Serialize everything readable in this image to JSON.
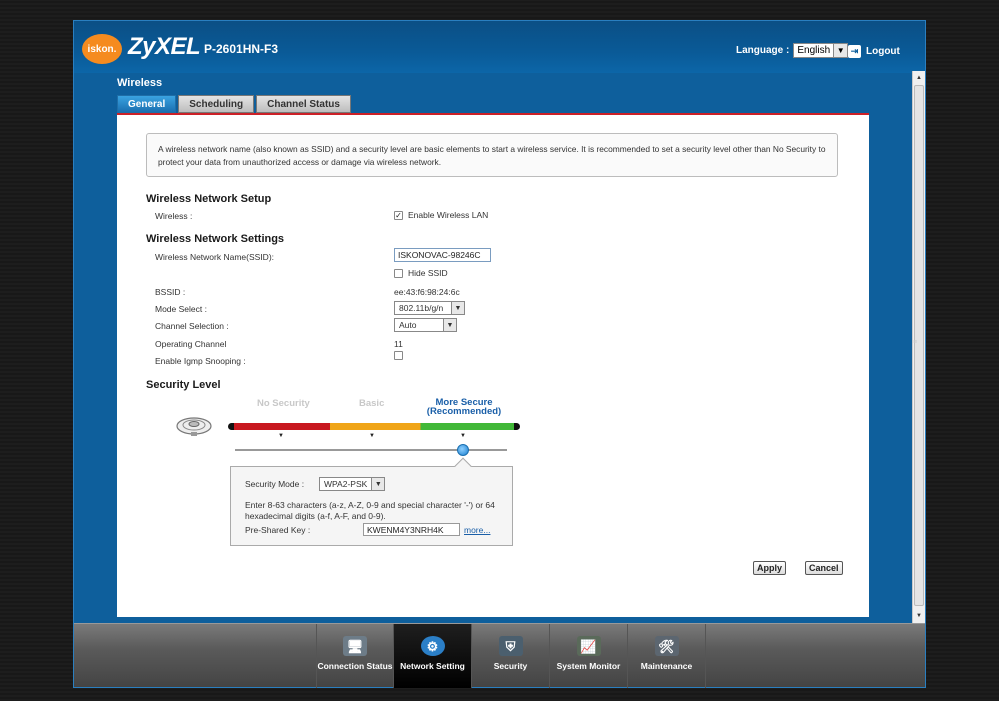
{
  "header": {
    "logo_text": "iskon.",
    "brand": "ZyXEL",
    "model": "P-2601HN-F3",
    "language_label": "Language :",
    "language_value": "English",
    "logout_label": "Logout"
  },
  "page": {
    "title": "Wireless",
    "tabs": [
      {
        "label": "General",
        "active": true
      },
      {
        "label": "Scheduling",
        "active": false
      },
      {
        "label": "Channel Status",
        "active": false
      }
    ]
  },
  "info_text": "A wireless network name (also known as SSID) and a security level are basic elements to start a wireless service. It is recommended to set a security level other than No Security to protect your data from unauthorized access or damage via wireless network.",
  "network_setup": {
    "title": "Wireless Network Setup",
    "wireless_label": "Wireless :",
    "enable_label": "Enable Wireless LAN",
    "enable_checked": true
  },
  "network_settings": {
    "title": "Wireless Network Settings",
    "ssid_label": "Wireless Network Name(SSID):",
    "ssid_value": "ISKONOVAC-98246C",
    "hide_ssid_label": "Hide SSID",
    "hide_ssid_checked": false,
    "bssid_label": "BSSID :",
    "bssid_value": "ee:43:f6:98:24:6c",
    "mode_label": "Mode Select :",
    "mode_value": "802.11b/g/n",
    "channel_label": "Channel Selection :",
    "channel_value": "Auto",
    "operating_label": "Operating Channel",
    "operating_value": "11",
    "igmp_label": "Enable Igmp Snooping :",
    "igmp_checked": false
  },
  "security": {
    "title": "Security Level",
    "levels": [
      "No Security",
      "Basic",
      "More Secure\n(Recommended)"
    ],
    "level_colors": {
      "No Security": "#c8181f",
      "Basic": "#f0a518",
      "More Secure": "#41b838"
    },
    "selected_level": "More Secure (Recommended)",
    "mode_label": "Security Mode :",
    "mode_value": "WPA2-PSK",
    "hint": "Enter 8-63 characters (a-z, A-Z, 0-9 and special character '-') or 64 hexadecimal digits (a-f, A-F, and 0-9).",
    "psk_label": "Pre-Shared Key :",
    "psk_value": "KWENM4Y3NRH4K",
    "more_label": "more..."
  },
  "actions": {
    "apply_label": "Apply",
    "cancel_label": "Cancel"
  },
  "bottom_nav": [
    {
      "label": "Connection Status",
      "icon": "connection-status-icon",
      "active": false
    },
    {
      "label": "Network Setting",
      "icon": "network-setting-icon",
      "active": true
    },
    {
      "label": "Security",
      "icon": "security-shield-icon",
      "active": false
    },
    {
      "label": "System Monitor",
      "icon": "system-monitor-icon",
      "active": false
    },
    {
      "label": "Maintenance",
      "icon": "maintenance-icon",
      "active": false
    }
  ],
  "colors": {
    "accent_blue": "#0e5f9c",
    "logo_orange": "#f58b1f",
    "tab_active": "#1a6fb0",
    "divider_red": "#cc2027"
  }
}
